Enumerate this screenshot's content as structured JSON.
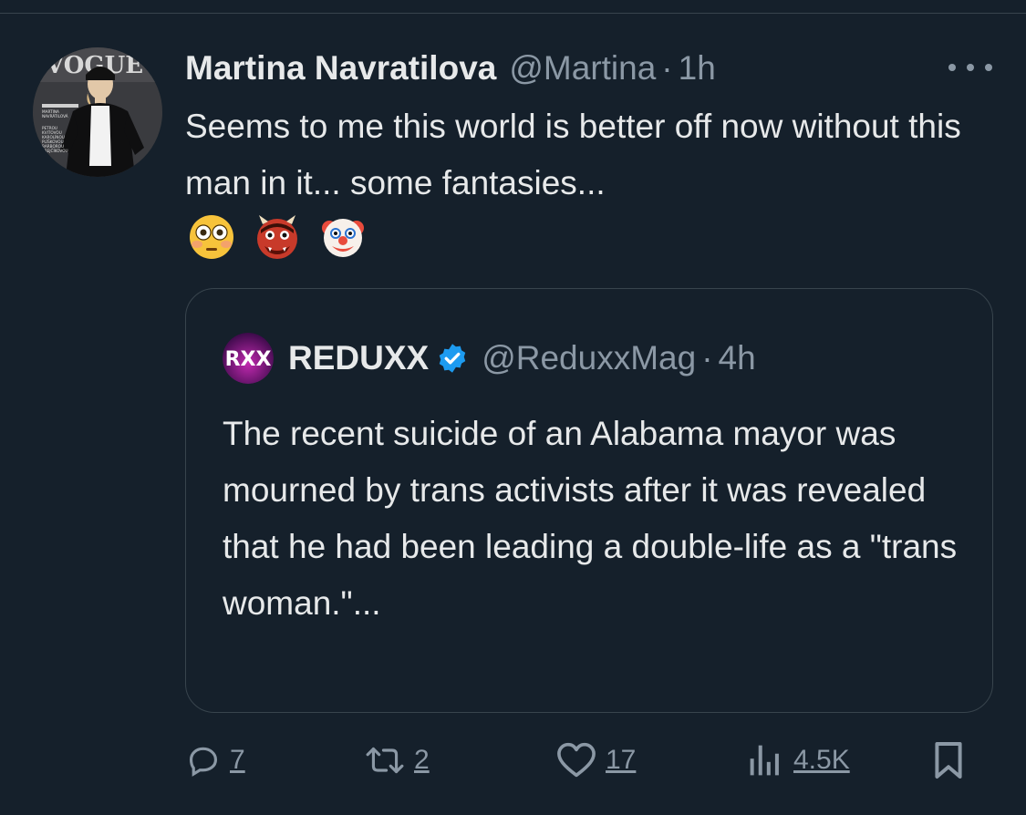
{
  "tweet": {
    "author_name": "Martina Navratilova",
    "author_handle": "@Martina",
    "separator": "·",
    "time": "1h",
    "text": "Seems to me this world is better off now without this man in it... some fantasies...",
    "emojis": [
      "flushed-face",
      "ogre",
      "clown-face"
    ],
    "avatar_text": [
      "MARTINA",
      "NAVRÁTILOVÁ",
      "PETROU",
      "KVITOVOU",
      "KAROLÍNOU",
      "PLÍŠKOVOU",
      "BARBOROU",
      "KREJČÍKOVOU"
    ]
  },
  "quote": {
    "author_name": "REDUXX",
    "avatar_label": "RXX",
    "verified": true,
    "author_handle": "@ReduxxMag",
    "separator": "·",
    "time": "4h",
    "text": "The recent suicide of an Alabama mayor was mourned by trans activists after it was revealed that he had been leading a double-life as a \"trans woman.\"..."
  },
  "actions": {
    "replies": "7",
    "retweets": "2",
    "likes": "17",
    "views": "4.5K"
  },
  "colors": {
    "background": "#15202b",
    "text": "#e7e9ea",
    "secondary": "#8b98a5",
    "border": "#38444d",
    "verified": "#1d9bf0"
  }
}
